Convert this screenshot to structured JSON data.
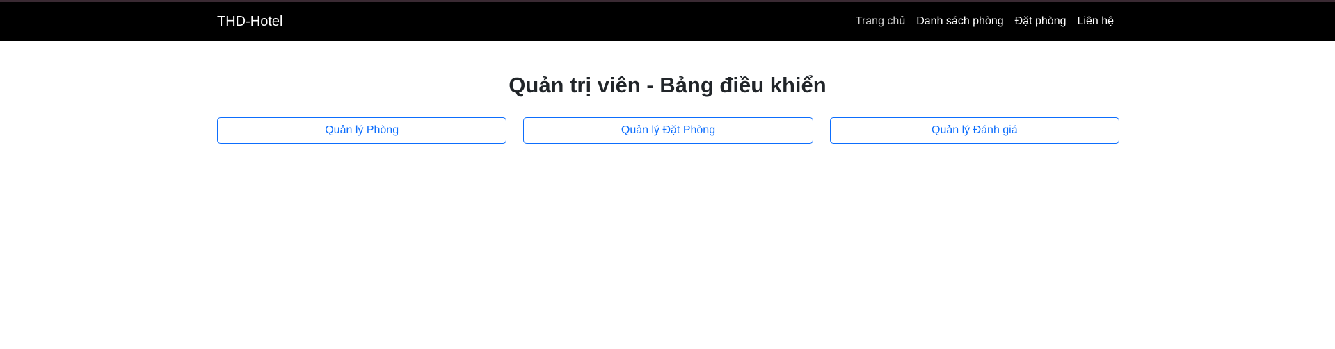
{
  "navbar": {
    "brand": "THD-Hotel",
    "links": [
      {
        "label": "Trang chủ",
        "active": true
      },
      {
        "label": "Danh sách phòng",
        "active": false
      },
      {
        "label": "Đặt phòng",
        "active": false
      },
      {
        "label": "Liên hệ",
        "active": false
      }
    ]
  },
  "main": {
    "title": "Quản trị viên - Bảng điều khiển",
    "buttons": [
      {
        "label": "Quản lý Phòng"
      },
      {
        "label": "Quản lý Đặt Phòng"
      },
      {
        "label": "Quản lý Đánh giá"
      }
    ]
  },
  "colors": {
    "navbar_bg": "#000000",
    "accent": "#0d6efd",
    "title_text": "#212529"
  }
}
